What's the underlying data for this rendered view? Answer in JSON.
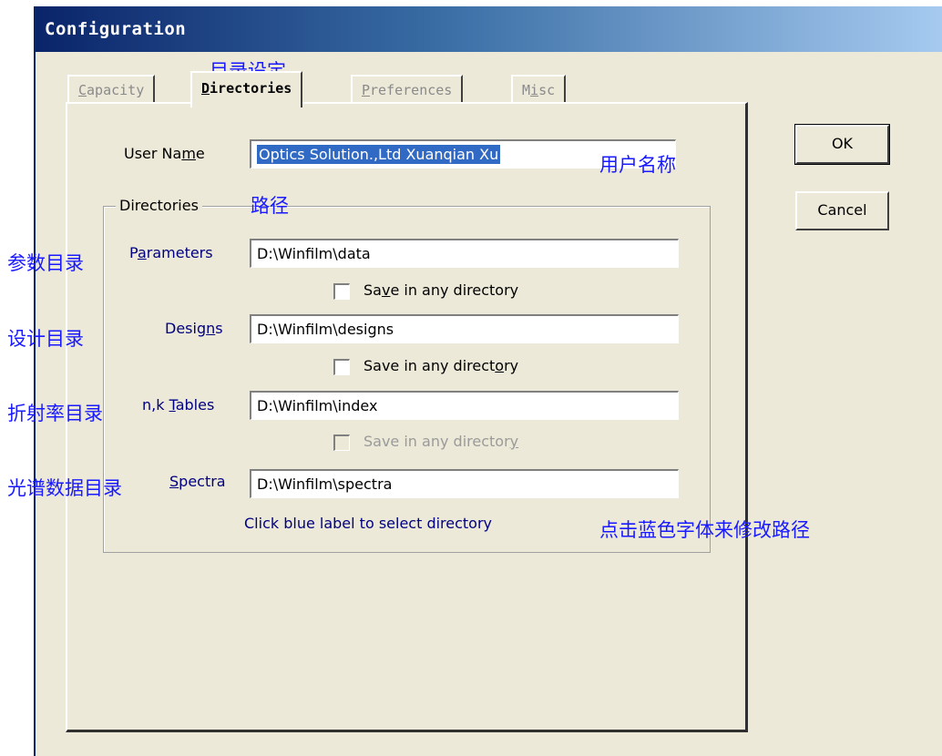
{
  "window": {
    "title": "Configuration"
  },
  "tabs": [
    {
      "pre": "",
      "key": "C",
      "post": "apacity",
      "active": false
    },
    {
      "pre": "",
      "key": "D",
      "post": "irectories",
      "active": true
    },
    {
      "pre": "",
      "key": "P",
      "post": "references",
      "active": false
    },
    {
      "pre": "M",
      "key": "i",
      "post": "sc",
      "active": false
    }
  ],
  "user_name": {
    "label_pre": "User Na",
    "label_key": "m",
    "label_post": "e",
    "value": "Optics Solution.,Ltd Xuanqian Xu"
  },
  "directories": {
    "legend": "Directories",
    "parameters": {
      "label_pre": "P",
      "label_key": "a",
      "label_post": "rameters",
      "value": "D:\\Winfilm\\data",
      "cb_pre": "Sa",
      "cb_key": "v",
      "cb_post": "e in any directory"
    },
    "designs": {
      "label_pre": "Desig",
      "label_key": "n",
      "label_post": "s",
      "value": "D:\\Winfilm\\designs",
      "cb_pre": "Save in any direct",
      "cb_key": "o",
      "cb_post": "ry"
    },
    "tables": {
      "label_pre": "n,k ",
      "label_key": "T",
      "label_post": "ables",
      "value": "D:\\Winfilm\\index",
      "cb_pre": "Save in any director",
      "cb_key": "y",
      "cb_post": ""
    },
    "spectra": {
      "label_pre": "",
      "label_key": "S",
      "label_post": "pectra",
      "value": "D:\\Winfilm\\spectra"
    },
    "hint": "Click blue label to select directory"
  },
  "buttons": {
    "ok": "OK",
    "cancel": "Cancel"
  },
  "annotations": {
    "tab_dir": "目录设定",
    "user_name": "用户名称",
    "path": "路径",
    "params": "参数目录",
    "designs": "设计目录",
    "index": "折射率目录",
    "spectra": "光谱数据目录",
    "hint": "点击蓝色字体来修改路径"
  }
}
